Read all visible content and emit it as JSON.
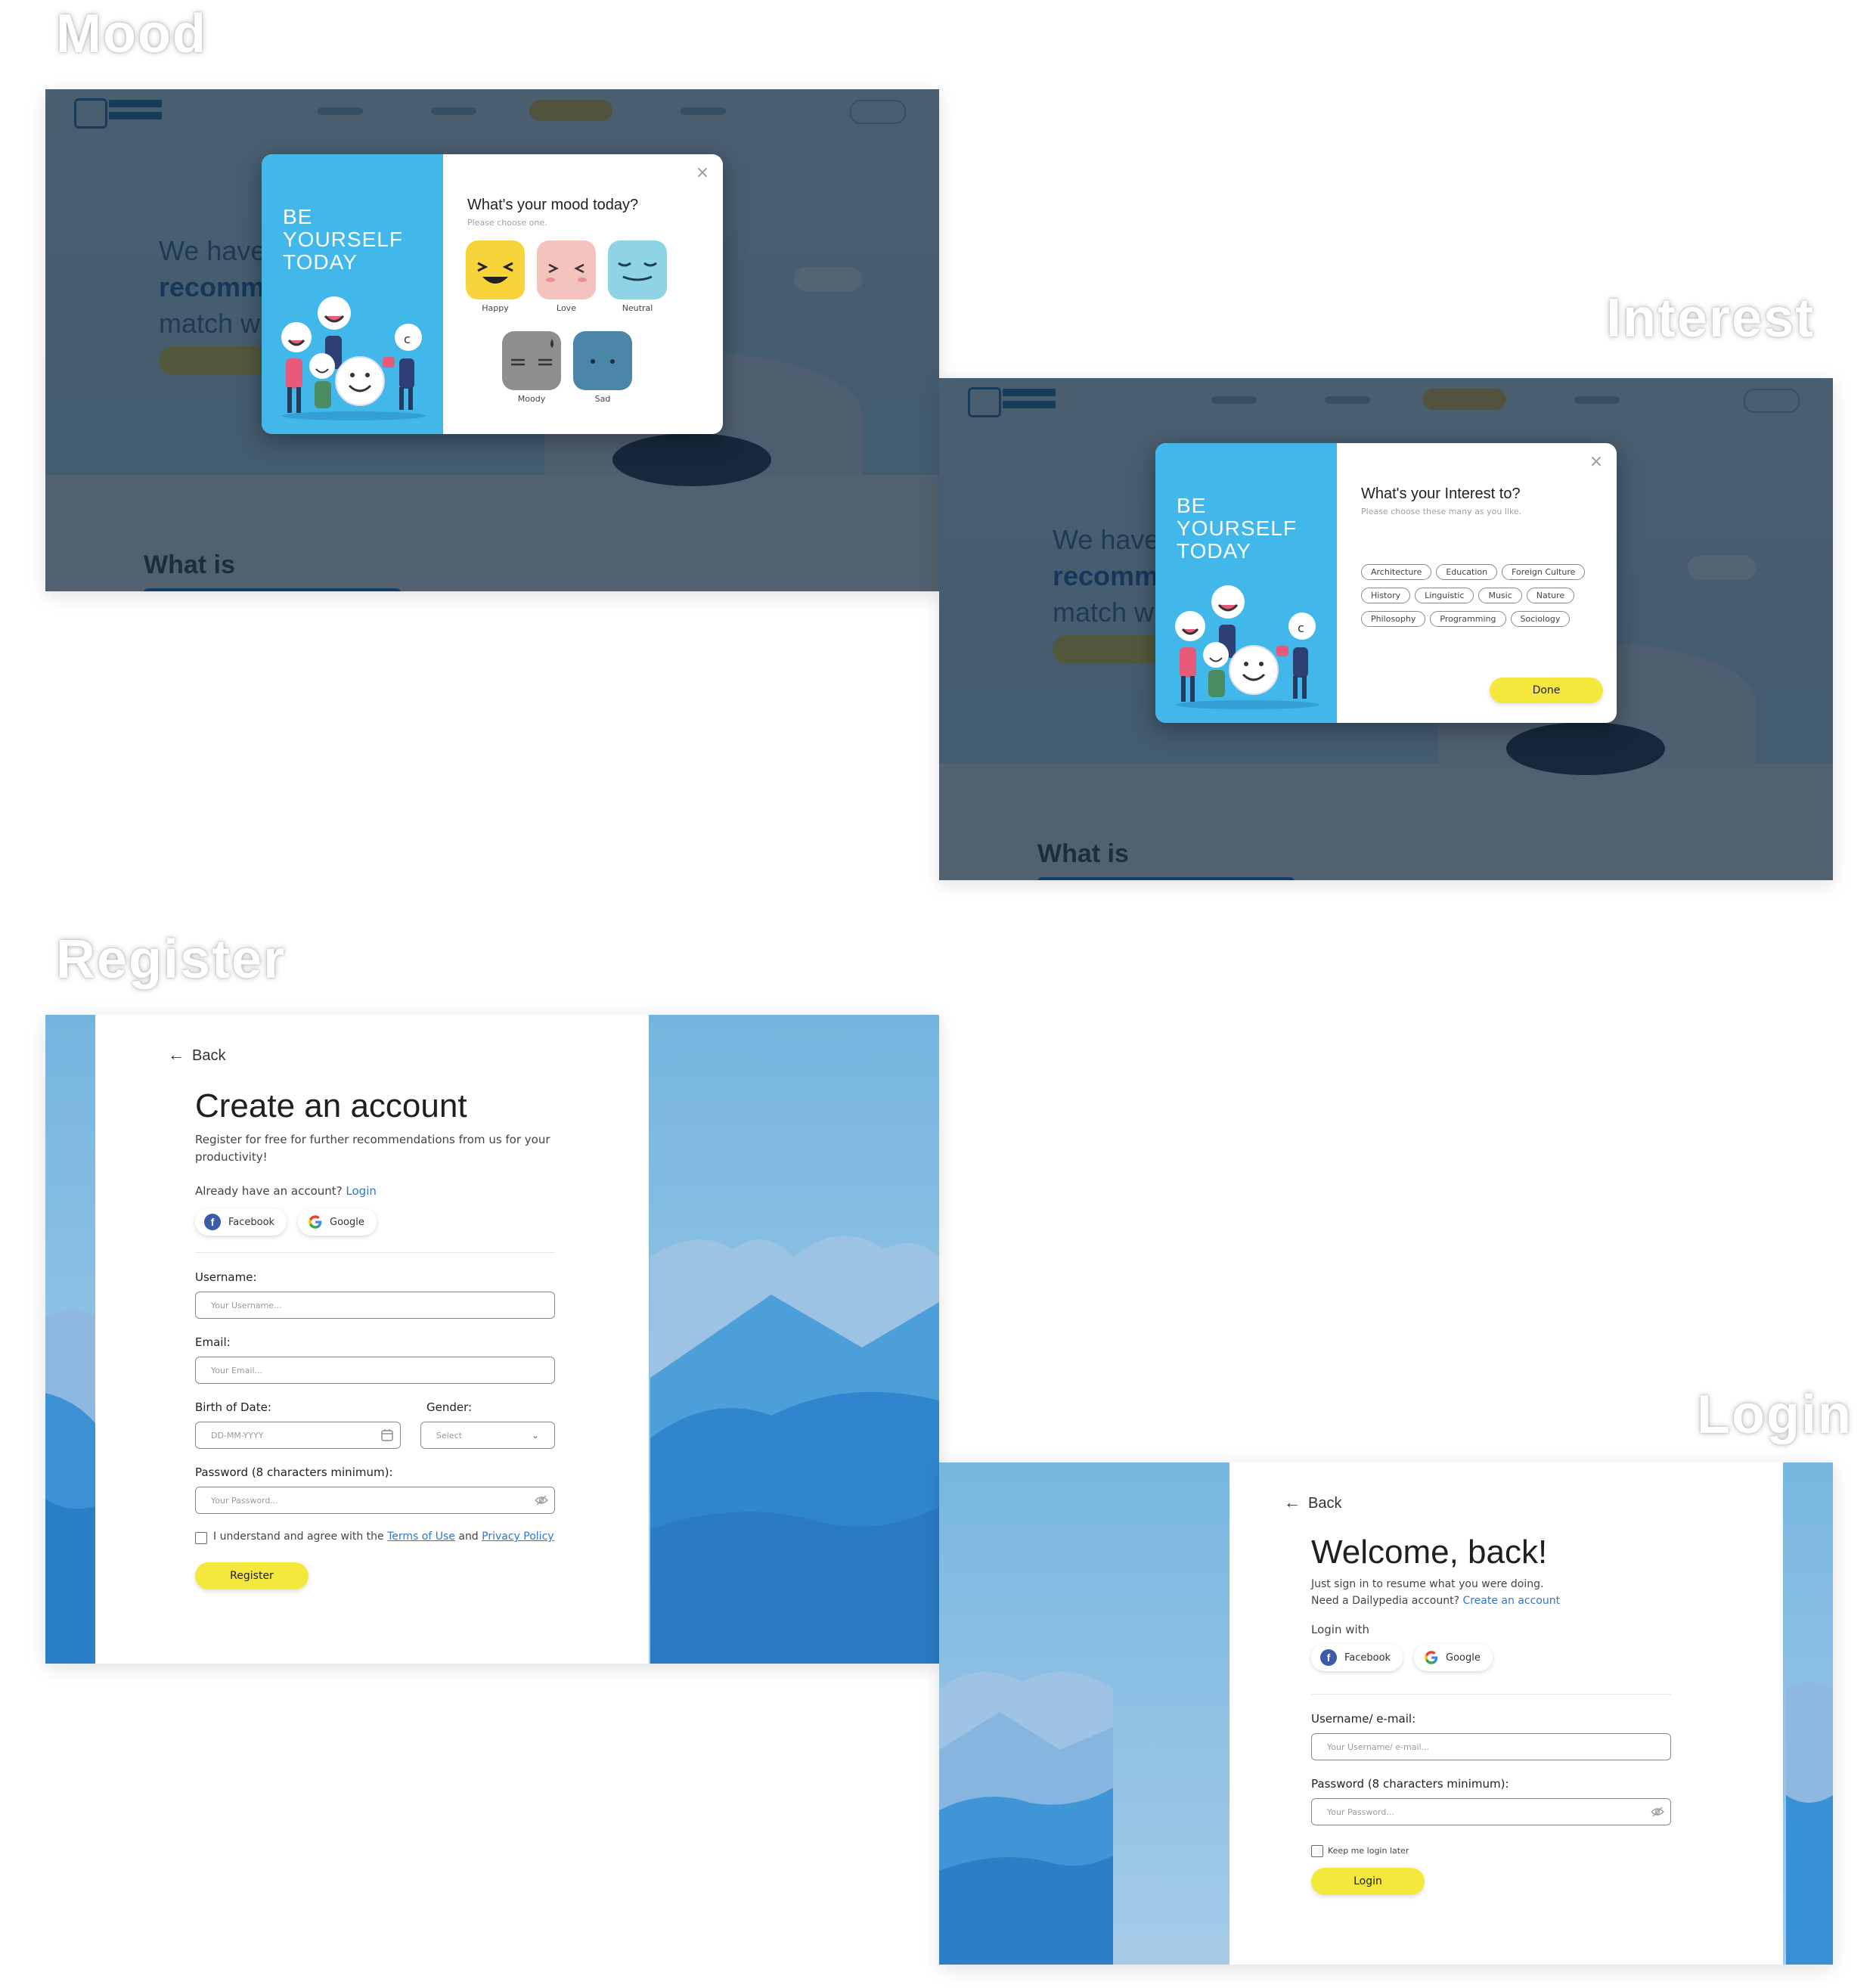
{
  "sections": {
    "mood": "Mood",
    "interest": "Interest",
    "register": "Register",
    "login": "Login"
  },
  "colors": {
    "brand_blue": "#41b7ea",
    "accent_yellow": "#f5e83c",
    "link_blue": "#2f78c9"
  },
  "modal": {
    "tagline": [
      "BE",
      "YOURSELF",
      "TODAY"
    ]
  },
  "mood_modal": {
    "title": "What's your mood today?",
    "subtitle": "Please choose one.",
    "moods": [
      {
        "label": "Happy",
        "color": "#f7d43a"
      },
      {
        "label": "Love",
        "color": "#f4c3bd"
      },
      {
        "label": "Neutral",
        "color": "#8fd3e6"
      },
      {
        "label": "Moody",
        "color": "#8e8e8e"
      },
      {
        "label": "Sad",
        "color": "#4a86a8"
      }
    ]
  },
  "interest_modal": {
    "title": "What's your Interest to?",
    "subtitle": "Please choose these many as you like.",
    "chips": [
      [
        "Architecture",
        "Education",
        "Foreign Culture"
      ],
      [
        "History",
        "Linguistic",
        "Music",
        "Nature"
      ],
      [
        "Philosophy",
        "Programming",
        "Sociology"
      ]
    ],
    "done_label": "Done"
  },
  "register": {
    "back_label": "Back",
    "title": "Create an account",
    "description": "Register for free for further recommendations from us for your productivity!",
    "already_text": "Already have an account?",
    "login_link": "Login",
    "facebook_label": "Facebook",
    "google_label": "Google",
    "username_label": "Username:",
    "username_placeholder": "Your Username...",
    "email_label": "Email:",
    "email_placeholder": "Your Email...",
    "birth_label": "Birth of Date:",
    "birth_placeholder": "DD-MM-YYYY",
    "gender_label": "Gender:",
    "gender_value": "Select",
    "password_label": "Password (8 characters minimum):",
    "password_placeholder": "Your Password...",
    "agree_text": "I understand and agree with the",
    "terms_link": "Terms of Use",
    "and_text": "and",
    "privacy_link": "Privacy Policy",
    "register_label": "Register"
  },
  "login": {
    "back_label": "Back",
    "title": "Welcome, back!",
    "line1": "Just sign in to resume what you were doing.",
    "line2": "Need a Dailypedia account?",
    "create_link": "Create an account",
    "login_with": "Login with",
    "facebook_label": "Facebook",
    "google_label": "Google",
    "username_label": "Username/ e-mail:",
    "username_placeholder": "Your Username/ e-mail...",
    "password_label": "Password (8 characters minimum):",
    "password_placeholder": "Your Password...",
    "keep_label": "Keep me login later",
    "login_label": "Login"
  }
}
